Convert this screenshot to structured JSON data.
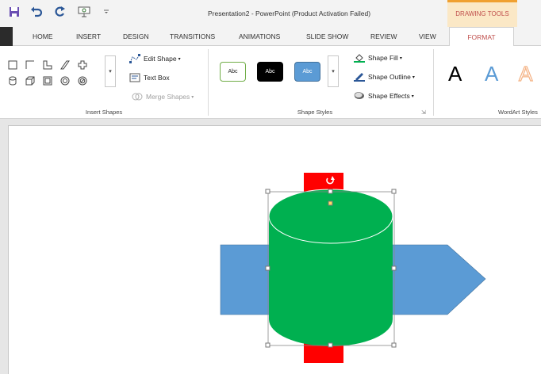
{
  "window": {
    "title": "Presentation2 - PowerPoint (Product Activation Failed)",
    "context_tool_label": "DRAWING TOOLS",
    "accent_color": "#c0504d"
  },
  "quick_access": [
    "save-icon",
    "undo-icon",
    "redo-icon",
    "start-from-beginning-icon",
    "customize-qat-icon"
  ],
  "tabs": [
    {
      "label": "HOME"
    },
    {
      "label": "INSERT"
    },
    {
      "label": "DESIGN"
    },
    {
      "label": "TRANSITIONS"
    },
    {
      "label": "ANIMATIONS"
    },
    {
      "label": "SLIDE SHOW"
    },
    {
      "label": "REVIEW"
    },
    {
      "label": "VIEW"
    },
    {
      "label": "FORMAT"
    }
  ],
  "ribbon": {
    "insert_shapes": {
      "label": "Insert Shapes",
      "edit_shape": "Edit Shape",
      "text_box": "Text Box",
      "merge_shapes": "Merge Shapes"
    },
    "shape_styles": {
      "label": "Shape Styles",
      "swatch_text": "Abc",
      "swatches": [
        {
          "fill": "#ffffff",
          "border": "#70ad47",
          "text_color": "#222222"
        },
        {
          "fill": "#000000",
          "border": "#000000",
          "text_color": "#ffffff"
        },
        {
          "fill": "#5b9bd5",
          "border": "#41719c",
          "text_color": "#ffffff"
        }
      ],
      "shape_fill": "Shape Fill",
      "shape_outline": "Shape Outline",
      "shape_effects": "Shape Effects"
    },
    "wordart_styles": {
      "label": "WordArt Styles",
      "samples": [
        {
          "text": "A",
          "color": "#000000"
        },
        {
          "text": "A",
          "color": "#5b9bd5"
        },
        {
          "text": "A",
          "color": "#f4b183"
        }
      ]
    }
  },
  "slide": {
    "shapes": [
      {
        "type": "rectangle",
        "fill": "#ff0000"
      },
      {
        "type": "pentagon-arrow",
        "fill": "#5b9bd5"
      },
      {
        "type": "cylinder",
        "fill": "#00b050",
        "selected": true
      }
    ]
  }
}
